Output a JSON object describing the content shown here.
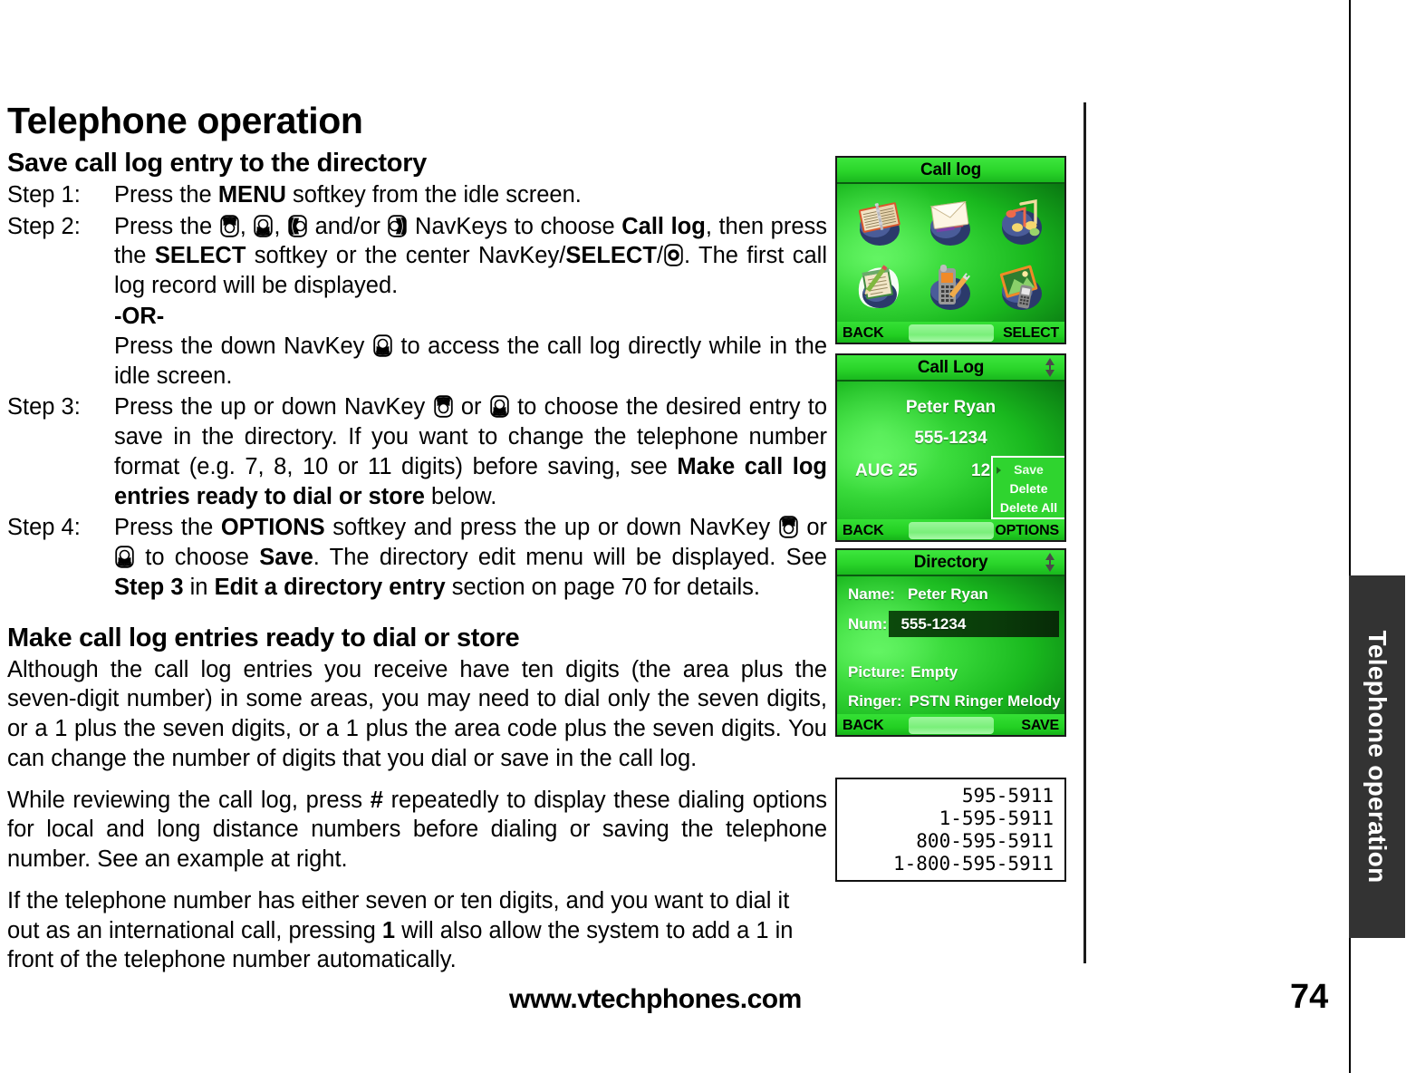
{
  "document": {
    "title": "Telephone operation",
    "side_tab_label": "Telephone operation",
    "footer_url": "www.vtechphones.com",
    "page_number": "74"
  },
  "sections": {
    "save_call_log": {
      "heading": "Save call log entry to the directory",
      "step1": {
        "label": "Step 1:",
        "text_a": "Press the ",
        "bold_menu": "MENU",
        "text_b": " softkey from the idle screen."
      },
      "step2": {
        "label": "Step 2:",
        "t1": "Press the ",
        "t2": ", ",
        "t3": ", ",
        "t4": " and/or ",
        "t5": " NavKeys to choose ",
        "bold_calllog": "Call log",
        "t6": ", then press the ",
        "bold_select": "SELECT",
        "t7": " softkey or the center NavKey/",
        "bold_select2": "SELECT",
        "t8": "/",
        "t9": ". The first call log record will be displayed.",
        "or_label": "-OR-",
        "or_text_a": "Press the down NavKey ",
        "or_text_b": " to access the call log directly while in the idle screen."
      },
      "step3": {
        "label": "Step 3:",
        "t1": "Press the up or down NavKey ",
        "t2": " or ",
        "t3": " to choose the desired entry to save in the directory. If you want to change the telephone number format (e.g. 7, 8, 10 or 11 digits) before saving, see ",
        "bold_ref": "Make call log entries ready to dial or store",
        "t4": " below."
      },
      "step4": {
        "label": "Step 4:",
        "t1": "Press the ",
        "bold_options": "OPTIONS",
        "t2": " softkey and press the up or down NavKey ",
        "t3": " or ",
        "t4": " to choose ",
        "bold_save": "Save",
        "t5": ". The directory edit menu will be displayed. See ",
        "bold_step3": "Step 3",
        "t6": " in ",
        "bold_edit": "Edit a directory entry",
        "t7": " section on page 70 for details."
      }
    },
    "make_ready": {
      "heading": "Make call log entries ready to dial or store",
      "para1": "Although the call log entries you receive have ten digits (the area plus the seven-digit number) in some areas, you may need to dial only the seven digits, or a 1 plus the seven digits,  or a 1 plus the area code plus the seven digits. You can change the number of digits that you dial or save in the call log.",
      "para2_a": "While reviewing the call log, press ",
      "para2_hash": "#",
      "para2_b": " repeatedly to display these dialing options for local and long distance numbers before dialing or saving the telephone number. See an example at right.",
      "para3_a": "If the telephone number has either seven or ten digits, and you want to dial it out as an international call, pressing ",
      "para3_one": "1",
      "para3_b": " will also allow the system to add a 1 in front of the telephone number automatically."
    }
  },
  "figures": {
    "menu_screen": {
      "title": "Call log",
      "softkey_left": "BACK",
      "softkey_right": "SELECT",
      "icons": [
        {
          "name": "directory-icon",
          "label": "Directory"
        },
        {
          "name": "message-icon",
          "label": "Message"
        },
        {
          "name": "ringer-icon",
          "label": "Ringer"
        },
        {
          "name": "call-log-icon",
          "label": "Call log",
          "selected": true
        },
        {
          "name": "phone-settings-icon",
          "label": "Phone settings"
        },
        {
          "name": "display-icon",
          "label": "Display"
        }
      ]
    },
    "call_log_screen": {
      "title": "Call Log",
      "scroll_indicator": "up-down-arrow-icon",
      "caller_name": "Peter Ryan",
      "caller_number": "555-1234",
      "date": "AUG 25",
      "time": "12:",
      "options": [
        {
          "label": "Save",
          "selected": true
        },
        {
          "label": "Delete",
          "selected": false
        },
        {
          "label": "Delete All",
          "selected": false
        }
      ],
      "softkey_left": "BACK",
      "softkey_right": "OPTIONS"
    },
    "directory_screen": {
      "title": "Directory",
      "scroll_indicator": "up-down-arrow-icon",
      "fields": [
        {
          "label": "Name:",
          "value": "Peter Ryan"
        },
        {
          "label": "Num:",
          "value": "555-1234"
        },
        {
          "label": "Picture:",
          "value": "Empty"
        },
        {
          "label": "Ringer:",
          "value": "PSTN Ringer Melody"
        }
      ],
      "softkey_left": "BACK",
      "softkey_right": "SAVE"
    },
    "lcd_example": {
      "lines": [
        "595-5911",
        "1-595-5911",
        "800-595-5911",
        "1-800-595-5911"
      ]
    }
  },
  "colors": {
    "screen_green_bright": "#2ad52a",
    "screen_green_dark": "#023506",
    "side_tab_bg": "#333333",
    "text": "#000000"
  }
}
